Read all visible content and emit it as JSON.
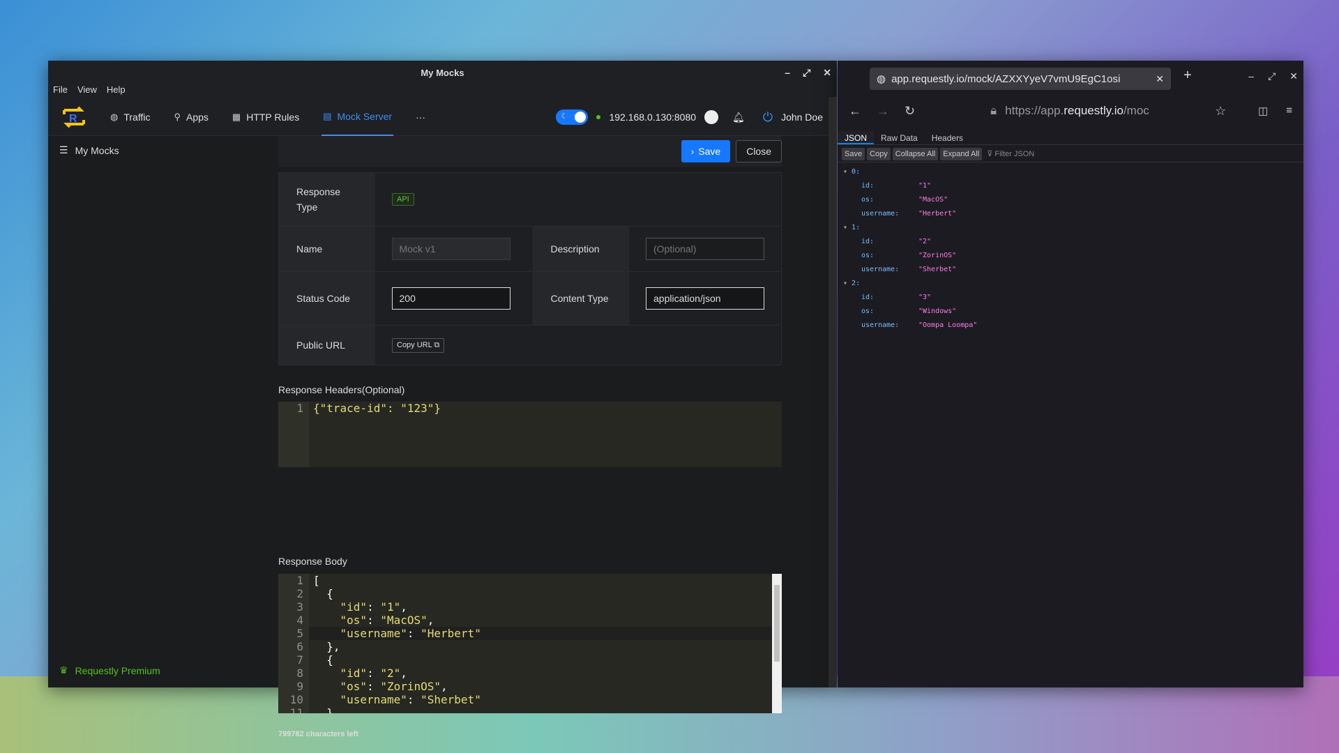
{
  "app": {
    "title": "My Mocks",
    "menu": [
      "File",
      "View",
      "Help"
    ],
    "nav": [
      "Traffic",
      "Apps",
      "HTTP Rules",
      "Mock Server",
      "···"
    ],
    "ip": "192.168.0.130:8080",
    "user": "John Doe",
    "sidebar_item": "My Mocks",
    "premium": "Requestly Premium",
    "save": "Save",
    "close": "Close",
    "form": {
      "response_type_label": "Response Type",
      "response_type_tag": "API",
      "name_label": "Name",
      "name_value": "Mock v1",
      "description_label": "Description",
      "description_placeholder": "(Optional)",
      "status_label": "Status Code",
      "status_value": "200",
      "content_type_label": "Content Type",
      "content_type_value": "application/json",
      "public_url_label": "Public URL",
      "copy_url": "Copy URL"
    },
    "headers_label": "Response Headers(Optional)",
    "headers_code": "{\"trace-id\": \"123\"}",
    "body_label": "Response Body",
    "body_lines": [
      "[",
      "  {",
      "    \"id\": \"1\",",
      "    \"os\": \"MacOS\",",
      "    \"username\": \"Herbert\"",
      "  },",
      "  {",
      "    \"id\": \"2\",",
      "    \"os\": \"ZorinOS\",",
      "    \"username\": \"Sherbet\"",
      "  }"
    ],
    "chars_left": "799782 characters left"
  },
  "browser": {
    "tab_title": "app.requestly.io/mock/AZXXYyeV7vmU9EgC1osi",
    "url_prefix": "https://app.",
    "url_domain": "requestly.io",
    "url_suffix": "/moc",
    "tabs": [
      "JSON",
      "Raw Data",
      "Headers"
    ],
    "tools": [
      "Save",
      "Copy",
      "Collapse All",
      "Expand All"
    ],
    "filter_placeholder": "Filter JSON",
    "items": [
      {
        "index": "0:",
        "id": "\"1\"",
        "os": "\"MacOS\"",
        "username": "\"Herbert\""
      },
      {
        "index": "1:",
        "id": "\"2\"",
        "os": "\"ZorinOS\"",
        "username": "\"Sherbet\""
      },
      {
        "index": "2:",
        "id": "\"3\"",
        "os": "\"Windows\"",
        "username": "\"Oompa Loompa\""
      }
    ]
  },
  "colors": {
    "accent": "#1677ff",
    "premium": "#52c41a",
    "json_key": "#75bfff",
    "json_string": "#ff7de9"
  }
}
